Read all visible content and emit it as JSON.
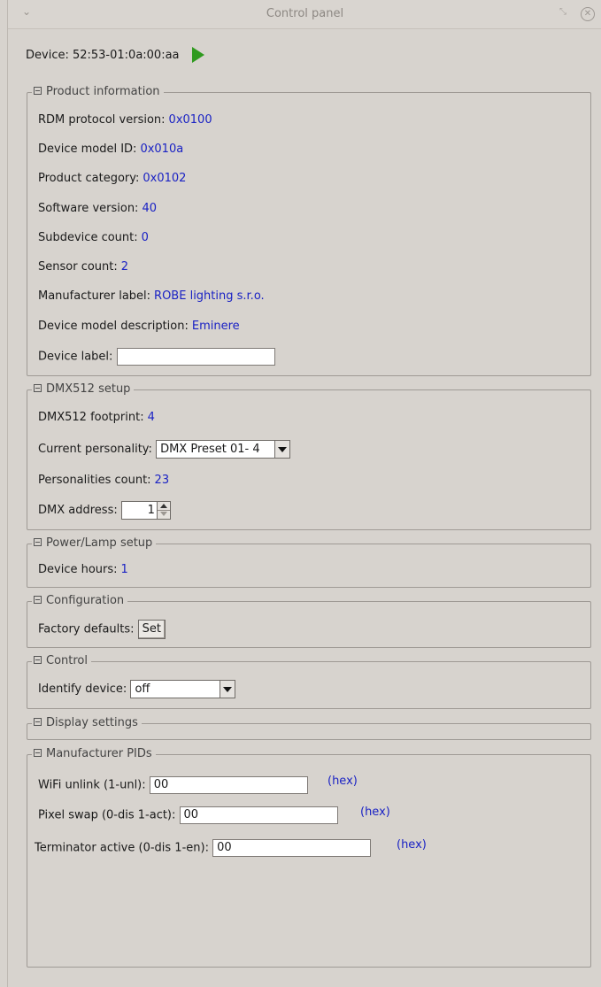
{
  "window": {
    "title": "Control panel"
  },
  "device": {
    "label": "Device: 52:53-01:0a:00:aa"
  },
  "product_information": {
    "title": "Product information",
    "rdm_protocol_label": "RDM protocol version:",
    "rdm_protocol_value": "0x0100",
    "model_id_label": "Device model ID:",
    "model_id_value": "0x010a",
    "category_label": "Product category:",
    "category_value": "0x0102",
    "software_label": "Software version:",
    "software_value": "40",
    "subdevice_label": "Subdevice count:",
    "subdevice_value": "0",
    "sensor_label": "Sensor count:",
    "sensor_value": "2",
    "manufacturer_label": "Manufacturer label:",
    "manufacturer_value": "ROBE lighting s.r.o.",
    "model_desc_label": "Device model description:",
    "model_desc_value": "Eminere",
    "device_label_label": "Device label:",
    "device_label_value": ""
  },
  "dmx_setup": {
    "title": "DMX512 setup",
    "footprint_label": "DMX512 footprint:",
    "footprint_value": "4",
    "personality_label": "Current personality:",
    "personality_value": "DMX Preset 01- 4",
    "personalities_count_label": "Personalities count:",
    "personalities_count_value": "23",
    "address_label": "DMX address:",
    "address_value": "1"
  },
  "power_lamp": {
    "title": "Power/Lamp setup",
    "hours_label": "Device hours:",
    "hours_value": "1"
  },
  "configuration": {
    "title": "Configuration",
    "factory_label": "Factory defaults:",
    "set_label": "Set"
  },
  "control": {
    "title": "Control",
    "identify_label": "Identify device:",
    "identify_value": "off"
  },
  "display_settings": {
    "title": "Display settings"
  },
  "manufacturer_pids": {
    "title": "Manufacturer PIDs",
    "wifi_label": "WiFi unlink (1-unl):",
    "wifi_value": "00",
    "pixel_label": "Pixel swap (0-dis 1-act):",
    "pixel_value": "00",
    "terminator_label": "Terminator active (0-dis 1-en):",
    "terminator_value": "00",
    "hex_label": "(hex)"
  },
  "colors": {
    "value_blue": "#1a22c4",
    "play_green": "#2f9a1f"
  }
}
